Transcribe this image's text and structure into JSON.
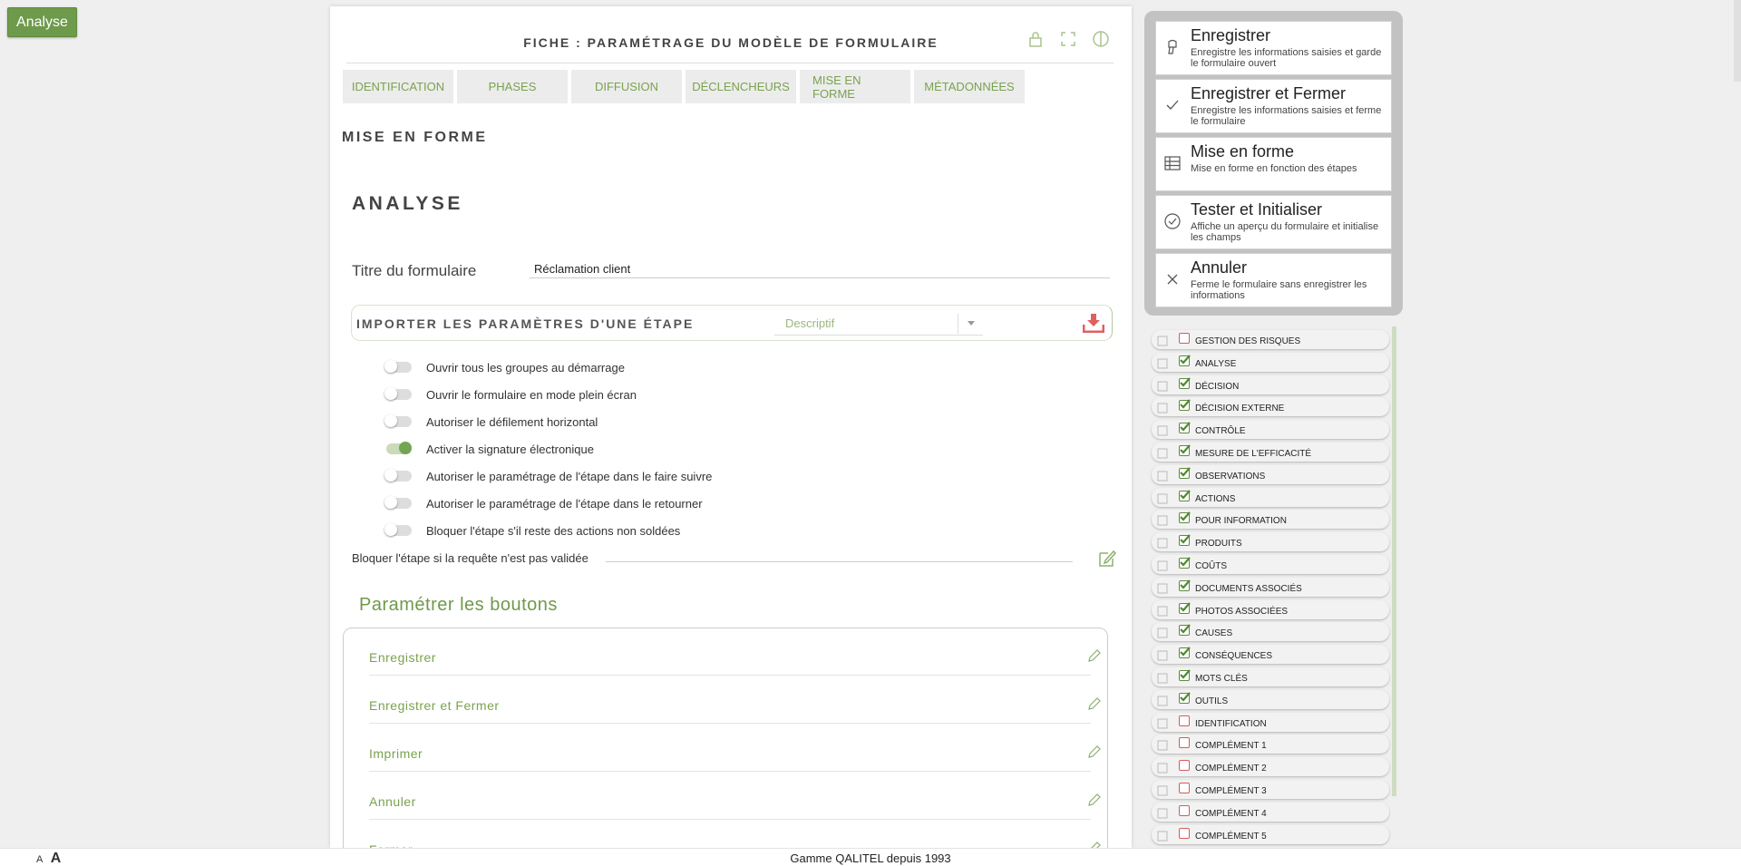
{
  "corner_button": "Analyse",
  "form": {
    "title": "FICHE : PARAMÉTRAGE DU MODÈLE DE FORMULAIRE",
    "tabs": [
      "IDENTIFICATION",
      "PHASES",
      "DIFFUSION",
      "DÉCLENCHEURS",
      "MISE EN FORME",
      "MÉTADONNÉES"
    ],
    "section": "MISE EN FORME",
    "subsection": "ANALYSE",
    "titre_label": "Titre du formulaire",
    "titre_value": "Réclamation client",
    "import_label": "IMPORTER LES PARAMÈTRES D'UNE ÉTAPE",
    "import_select": "Descriptif",
    "toggles": [
      {
        "label": "Ouvrir tous les groupes au démarrage",
        "on": false
      },
      {
        "label": "Ouvrir le formulaire en mode plein écran",
        "on": false
      },
      {
        "label": "Autoriser le défilement horizontal",
        "on": false
      },
      {
        "label": "Activer la signature électronique",
        "on": true
      },
      {
        "label": "Autoriser le paramétrage de l'étape dans le faire suivre",
        "on": false
      },
      {
        "label": "Autoriser le paramétrage de l'étape dans le retourner",
        "on": false
      },
      {
        "label": "Bloquer l'étape s'il reste des actions non soldées",
        "on": false
      }
    ],
    "block_label": "Bloquer l'étape si la requête n'est pas validée",
    "buttons_heading": "Paramétrer les boutons",
    "buttons": [
      "Enregistrer",
      "Enregistrer et Fermer",
      "Imprimer",
      "Annuler",
      "Fermer"
    ]
  },
  "actions": [
    {
      "title": "Enregistrer",
      "desc": "Enregistre les informations saisies et garde le formulaire ouvert",
      "icon": "save-icon"
    },
    {
      "title": "Enregistrer et Fermer",
      "desc": "Enregistre les informations saisies et ferme le formulaire",
      "icon": "check-icon"
    },
    {
      "title": "Mise en forme",
      "desc": "Mise en forme en fonction des étapes",
      "icon": "table-icon"
    },
    {
      "title": "Tester et Initialiser",
      "desc": "Affiche un aperçu du formulaire et initialise les champs",
      "icon": "check-circle-icon"
    },
    {
      "title": "Annuler",
      "desc": "Ferme le formulaire sans enregistrer les informations",
      "icon": "close-icon"
    }
  ],
  "steps": [
    {
      "label": "Gestion des risques",
      "checked": false
    },
    {
      "label": "Analyse",
      "checked": true
    },
    {
      "label": "Décision",
      "checked": true
    },
    {
      "label": "Décision externe",
      "checked": true
    },
    {
      "label": "Contrôle",
      "checked": true
    },
    {
      "label": "Mesure de l'efficacité",
      "checked": true
    },
    {
      "label": "Observations",
      "checked": true
    },
    {
      "label": "Actions",
      "checked": true
    },
    {
      "label": "Pour information",
      "checked": true
    },
    {
      "label": "Produits",
      "checked": true
    },
    {
      "label": "Coûts",
      "checked": true
    },
    {
      "label": "Documents associés",
      "checked": true
    },
    {
      "label": "Photos associées",
      "checked": true
    },
    {
      "label": "Causes",
      "checked": true
    },
    {
      "label": "Conséquences",
      "checked": true
    },
    {
      "label": "Mots clés",
      "checked": true
    },
    {
      "label": "Outils",
      "checked": true
    },
    {
      "label": "Identification",
      "checked": false
    },
    {
      "label": "Complément 1",
      "checked": false
    },
    {
      "label": "Complément 2",
      "checked": false
    },
    {
      "label": "Complément 3",
      "checked": false
    },
    {
      "label": "Complément 4",
      "checked": false
    },
    {
      "label": "Complément 5",
      "checked": false
    }
  ],
  "footer": {
    "font_small": "A",
    "font_big": "A",
    "brand": "Gamme QALITEL depuis 1993"
  },
  "colors": {
    "accent": "#6e9a4b",
    "link": "#7aa24f",
    "danger": "#d85a5a"
  }
}
